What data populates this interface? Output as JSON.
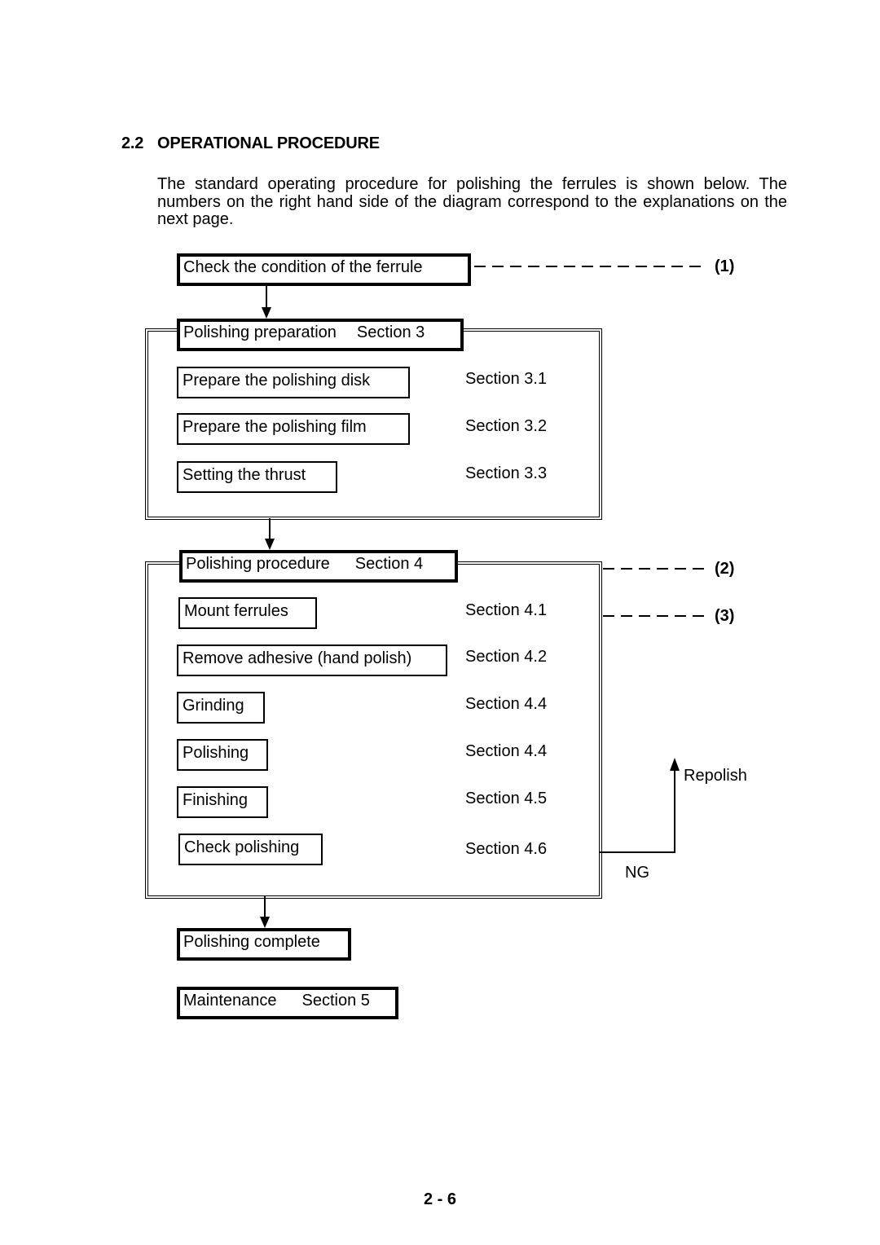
{
  "section": {
    "number": "2.2",
    "title": "OPERATIONAL PROCEDURE"
  },
  "intro_text": "The standard operating procedure for polishing the ferrules is shown below. The numbers on the right hand side of the diagram correspond to the explanations on the next page.",
  "flow": {
    "check_condition": "Check the condition of the ferrule",
    "preparation": {
      "title": "Polishing preparation",
      "section": "Section 3",
      "steps": [
        {
          "label": "Prepare the polishing disk",
          "section": "Section 3.1"
        },
        {
          "label": "Prepare the polishing film",
          "section": "Section 3.2"
        },
        {
          "label": "Setting the thrust",
          "section": "Section 3.3"
        }
      ]
    },
    "procedure": {
      "title": "Polishing procedure",
      "section": "Section 4",
      "steps": [
        {
          "label": "Mount ferrules",
          "section": "Section 4.1"
        },
        {
          "label": "Remove adhesive (hand polish)",
          "section": "Section 4.2"
        },
        {
          "label": "Grinding",
          "section": "Section 4.4"
        },
        {
          "label": "Polishing",
          "section": "Section 4.4"
        },
        {
          "label": "Finishing",
          "section": "Section 4.5"
        },
        {
          "label": "Check polishing",
          "section": "Section 4.6"
        }
      ]
    },
    "complete": "Polishing complete",
    "maintenance": {
      "title": "Maintenance",
      "section": "Section 5"
    },
    "ng_label": "NG",
    "repolish_label": "Repolish",
    "refs": [
      "(1)",
      "(2)",
      "(3)"
    ]
  },
  "page_number": "2 - 6"
}
